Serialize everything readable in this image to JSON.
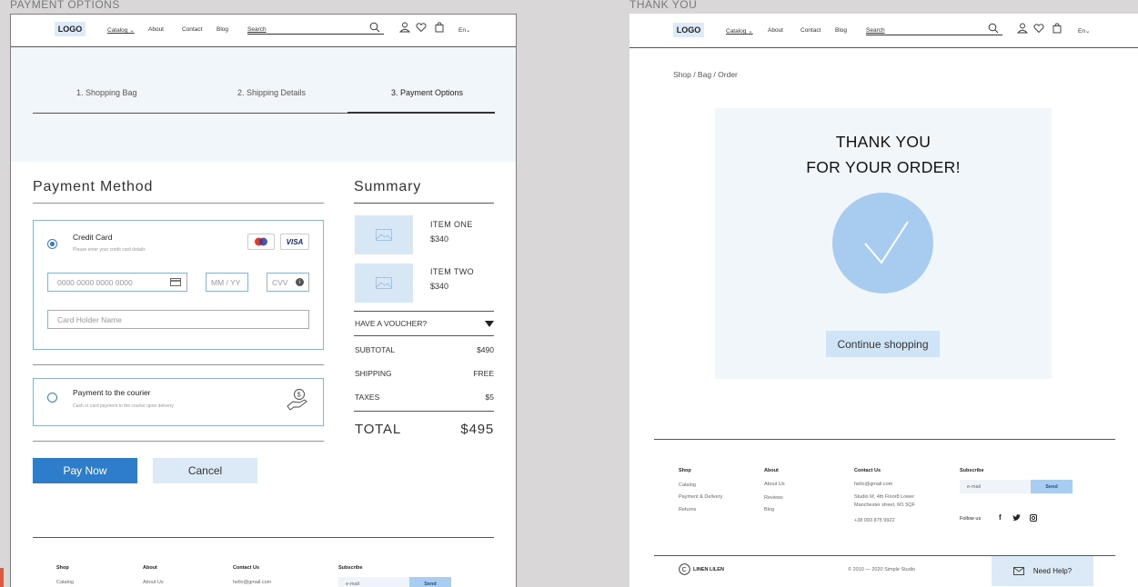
{
  "labels": {
    "left": "PAYMENT OPTIONS",
    "right": "THANK YOU"
  },
  "nav": {
    "logo": "LOGO",
    "catalog": "Catalog",
    "about": "About",
    "contact": "Contact",
    "blog": "Blog",
    "search": "Search",
    "lang": "En"
  },
  "steps": [
    "1. Shopping Bag",
    "2. Shipping Details",
    "3. Payment Options"
  ],
  "payment": {
    "title": "Payment Method",
    "card_label": "Credit Card",
    "card_sub": "Please enter your credit card details",
    "visa": "VISA",
    "card_number_placeholder": "0000  0000  0000  0000",
    "expiry_placeholder": "MM / YY",
    "cvv_placeholder": "CVV",
    "holder_placeholder": "Card Holder Name",
    "courier_label": "Payment to the courier",
    "courier_sub": "Cash or card payment to the courier upon delivery",
    "pay_now": "Pay Now",
    "cancel": "Cancel"
  },
  "summary": {
    "title": "Summary",
    "items": [
      {
        "name": "ITEM ONE",
        "price": "$340"
      },
      {
        "name": "ITEM TWO",
        "price": "$340"
      }
    ],
    "voucher": "HAVE A VOUCHER?",
    "rows": [
      {
        "label": "SUBTOTAL",
        "value": "$490"
      },
      {
        "label": "SHIPPING",
        "value": "FREE"
      },
      {
        "label": "TAXES",
        "value": "$5"
      }
    ],
    "total_label": "TOTAL",
    "total_value": "$495"
  },
  "footer": {
    "shop": {
      "head": "Shop",
      "items": [
        "Catalog",
        "Payment & Delivery",
        "Returns"
      ]
    },
    "about": {
      "head": "About",
      "items": [
        "About Us",
        "Reviews",
        "Blog"
      ]
    },
    "contact": {
      "head": "Contact Us",
      "email": "hello@gmail.com",
      "address1": "Studio M, 4th Floor8 Lower",
      "address2": "Manchester street, M1 5QF",
      "phone": "+38 093 875 9922"
    },
    "subscribe": {
      "head": "Subscribe",
      "placeholder": "e-mail",
      "send": "Send",
      "follow": "Follow us"
    },
    "brand": "LINEN LILEN",
    "copyright": "© 2010 — 2020  Simple Studio",
    "help": "Need Help?"
  },
  "thankyou": {
    "breadcrumb": "Shop  /  Bag  /  Order",
    "line1": "THANK YOU",
    "line2": "FOR YOUR ORDER!",
    "continue": "Continue shopping"
  }
}
